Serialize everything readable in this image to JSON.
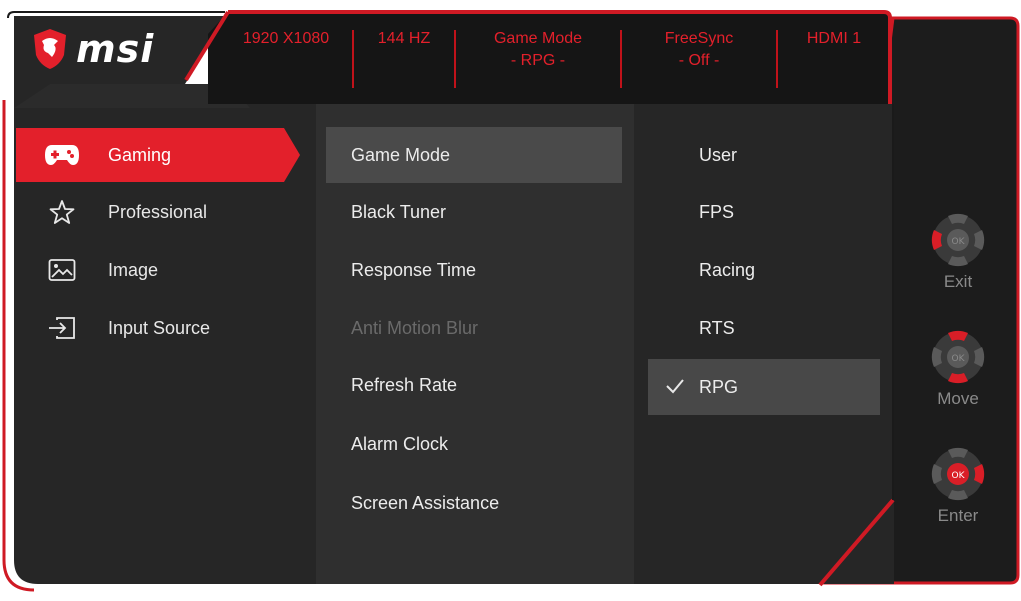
{
  "brand": {
    "logo_text": "msi"
  },
  "status_bar": [
    {
      "line1": "1920 X1080",
      "line2": ""
    },
    {
      "line1": "144 HZ",
      "line2": ""
    },
    {
      "line1": "Game Mode",
      "line2": "- RPG -"
    },
    {
      "line1": "FreeSync",
      "line2": "- Off -"
    },
    {
      "line1": "HDMI 1",
      "line2": ""
    }
  ],
  "categories": [
    {
      "label": "Gaming",
      "icon": "gamepad-icon",
      "active": true
    },
    {
      "label": "Professional",
      "icon": "star-icon",
      "active": false
    },
    {
      "label": "Image",
      "icon": "image-icon",
      "active": false
    },
    {
      "label": "Input Source",
      "icon": "input-source-icon",
      "active": false
    }
  ],
  "submenu": [
    {
      "label": "Game Mode",
      "state": "active"
    },
    {
      "label": "Black Tuner",
      "state": "normal"
    },
    {
      "label": "Response Time",
      "state": "normal"
    },
    {
      "label": "Anti Motion Blur",
      "state": "disabled"
    },
    {
      "label": "Refresh Rate",
      "state": "normal"
    },
    {
      "label": "Alarm Clock",
      "state": "normal"
    },
    {
      "label": "Screen Assistance",
      "state": "normal"
    }
  ],
  "options": [
    {
      "label": "User",
      "selected": false
    },
    {
      "label": "FPS",
      "selected": false
    },
    {
      "label": "Racing",
      "selected": false
    },
    {
      "label": "RTS",
      "selected": false
    },
    {
      "label": "RPG",
      "selected": true
    }
  ],
  "navigation": [
    {
      "label": "Exit",
      "icon": "joystick-left-icon"
    },
    {
      "label": "Move",
      "icon": "joystick-up-down-icon"
    },
    {
      "label": "Enter",
      "icon": "joystick-ok-icon"
    }
  ],
  "joystick_center_label": "OK",
  "colors": {
    "accent_red": "#e3202b",
    "panel_dark": "#262626",
    "panel_mid": "#2f2f2f",
    "highlight_gray": "#4a4a4a"
  }
}
